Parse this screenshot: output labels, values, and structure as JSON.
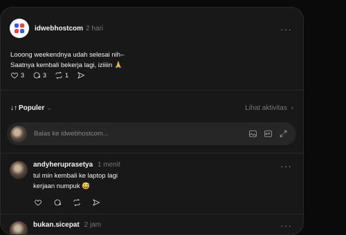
{
  "post": {
    "username": "idwebhostcom",
    "time": "2 hari",
    "more": "···",
    "text": "Looong weekendnya udah selesai nih–\nSaatnya kembali bekerja lagi, iziiiin 🙏",
    "likes": "3",
    "comments": "3",
    "reposts": "1"
  },
  "sort": {
    "label": "Populer",
    "icon": "↓↑",
    "activity_label": "Lihat aktivitas"
  },
  "reply": {
    "placeholder": "Balas ke idwebhostcom..."
  },
  "comments": [
    {
      "username": "andyheruprasetya",
      "time": "1 menit",
      "text": "tul min kembali ke laptop lagi\nkerjaan numpuk 😅"
    },
    {
      "username": "bukan.sicepat",
      "time": "2 jam"
    }
  ],
  "colors": {
    "background": "#0a0a0a",
    "card": "#181818",
    "muted": "#777777",
    "brand_blue": "#2f5bff",
    "brand_red": "#ff3d3d"
  }
}
